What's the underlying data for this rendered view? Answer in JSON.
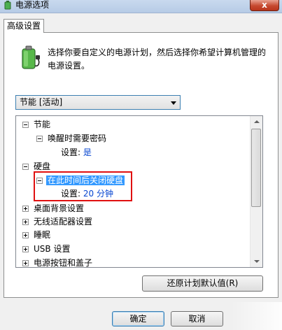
{
  "window": {
    "title": "电源选项",
    "close_label": "x"
  },
  "tabs": [
    {
      "label": "高级设置"
    }
  ],
  "intro": {
    "text": "选择你要自定义的电源计划，然后选择你希望计算机管理的电源设置。"
  },
  "plan_select": {
    "value": "节能 [活动]"
  },
  "tree": {
    "nodes": {
      "energy": "节能",
      "wake_password": "唤醒时需要密码",
      "wake_password_setting": "设置:",
      "wake_password_value": "是",
      "hard_disk": "硬盘",
      "turn_off_hd": "在此时间后关闭硬盘",
      "turn_off_hd_setting": "设置:",
      "turn_off_hd_value": "20 分钟",
      "desktop_bg": "桌面背景设置",
      "wireless": "无线适配器设置",
      "sleep": "睡眠",
      "usb": "USB 设置",
      "power_buttons": "电源按钮和盖子"
    }
  },
  "buttons": {
    "restore": "还原计划默认值(R)",
    "ok": "确定",
    "cancel": "取消"
  },
  "colors": {
    "selection": "#3399ff",
    "value_text": "#0645d0",
    "annotation": "#e01010"
  }
}
